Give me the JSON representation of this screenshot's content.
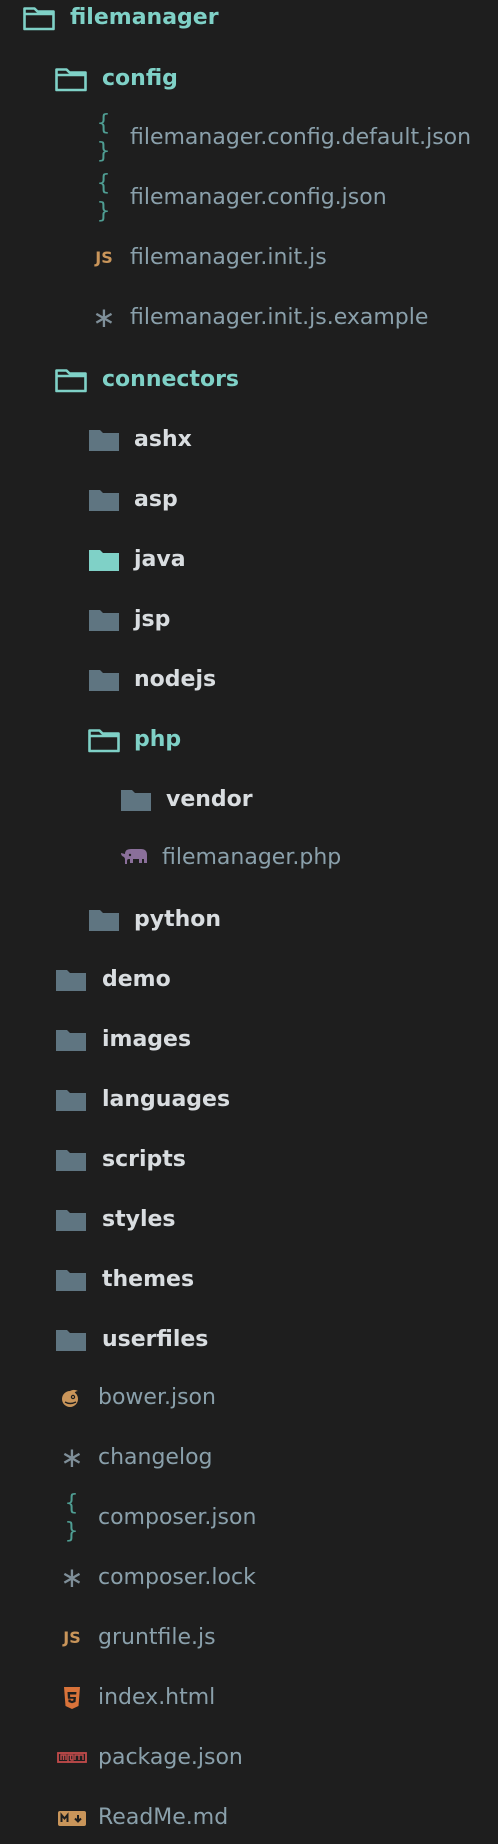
{
  "tree": {
    "root": {
      "label": "filemanager",
      "icon": "folder-open-icon"
    },
    "config": {
      "label": "config",
      "icon": "folder-open-icon"
    },
    "config_files": [
      {
        "label": "filemanager.config.default.json",
        "icon": "json-icon"
      },
      {
        "label": "filemanager.config.json",
        "icon": "json-icon"
      },
      {
        "label": "filemanager.init.js",
        "icon": "javascript-icon"
      },
      {
        "label": "filemanager.init.js.example",
        "icon": "asterisk-icon"
      }
    ],
    "connectors": {
      "label": "connectors",
      "icon": "folder-open-icon"
    },
    "connector_folders": [
      {
        "label": "ashx"
      },
      {
        "label": "asp"
      },
      {
        "label": "java"
      },
      {
        "label": "jsp"
      },
      {
        "label": "nodejs"
      }
    ],
    "php": {
      "label": "php",
      "icon": "folder-open-icon"
    },
    "vendor": {
      "label": "vendor"
    },
    "php_file": {
      "label": "filemanager.php",
      "icon": "php-elephant-icon"
    },
    "python": {
      "label": "python"
    },
    "top_folders": [
      {
        "label": "demo"
      },
      {
        "label": "images"
      },
      {
        "label": "languages"
      },
      {
        "label": "scripts"
      },
      {
        "label": "styles"
      },
      {
        "label": "themes"
      },
      {
        "label": "userfiles"
      }
    ],
    "top_files": [
      {
        "label": "bower.json",
        "icon": "bower-icon"
      },
      {
        "label": "changelog",
        "icon": "asterisk-icon"
      },
      {
        "label": "composer.json",
        "icon": "json-icon"
      },
      {
        "label": "composer.lock",
        "icon": "asterisk-icon"
      },
      {
        "label": "gruntfile.js",
        "icon": "javascript-icon"
      },
      {
        "label": "index.html",
        "icon": "html5-icon"
      },
      {
        "label": "package.json",
        "icon": "npm-icon"
      },
      {
        "label": "ReadMe.md",
        "icon": "markdown-icon"
      }
    ]
  },
  "icons": {
    "json": "{ }",
    "js": "JS",
    "asterisk": "∗",
    "markdown": "M↓",
    "npm": "npm"
  },
  "colors": {
    "background": "#1e1e1e",
    "folder_closed": "#5f7581",
    "folder_open_stroke": "#7fd1c7",
    "folder_highlight": "#7fd1c7",
    "open_label": "#7fd1c7",
    "folder_label": "#d9dde0",
    "file_label": "#8aa0ab",
    "php_elephant": "#8a6f9a",
    "html5": "#d9733a",
    "bower": "#c9955a"
  }
}
